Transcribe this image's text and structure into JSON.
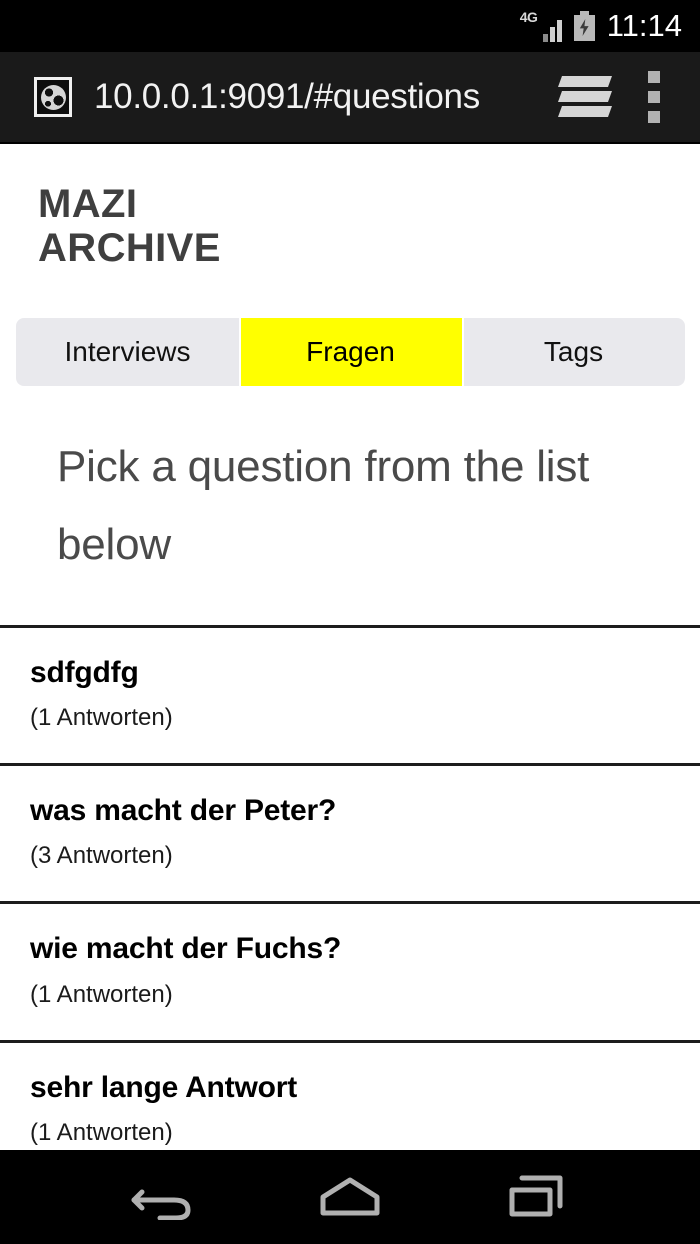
{
  "status_bar": {
    "network_label": "4G",
    "signal_icon": "signal-bars-icon",
    "battery_icon": "battery-charging-icon",
    "time": "11:14"
  },
  "browser": {
    "favicon": "globe-icon",
    "url": "10.0.0.1:9091/#questions",
    "tabs_icon": "browser-tabs-icon",
    "menu_icon": "overflow-menu-icon"
  },
  "app": {
    "brand_line1": "MAZI",
    "brand_line2": "ARCHIVE",
    "tabs": [
      {
        "label": "Interviews",
        "active": false
      },
      {
        "label": "Fragen",
        "active": true
      },
      {
        "label": "Tags",
        "active": false
      }
    ],
    "lead": "Pick a question from the list below",
    "questions": [
      {
        "title": "sdfgdfg",
        "answers": "(1 Antworten)"
      },
      {
        "title": "was macht der Peter?",
        "answers": "(3 Antworten)"
      },
      {
        "title": "wie macht der Fuchs?",
        "answers": "(1 Antworten)"
      },
      {
        "title": "sehr lange Antwort",
        "answers": "(1 Antworten)"
      }
    ]
  },
  "nav_bar": {
    "back_icon": "back-arrow-icon",
    "home_icon": "home-icon",
    "recents_icon": "recent-apps-icon"
  },
  "colors": {
    "accent_yellow": "#ffff00",
    "tab_inactive": "#e9e9ed",
    "brand_gray": "#3f3f3f",
    "chrome_black": "#1a1a1a"
  }
}
